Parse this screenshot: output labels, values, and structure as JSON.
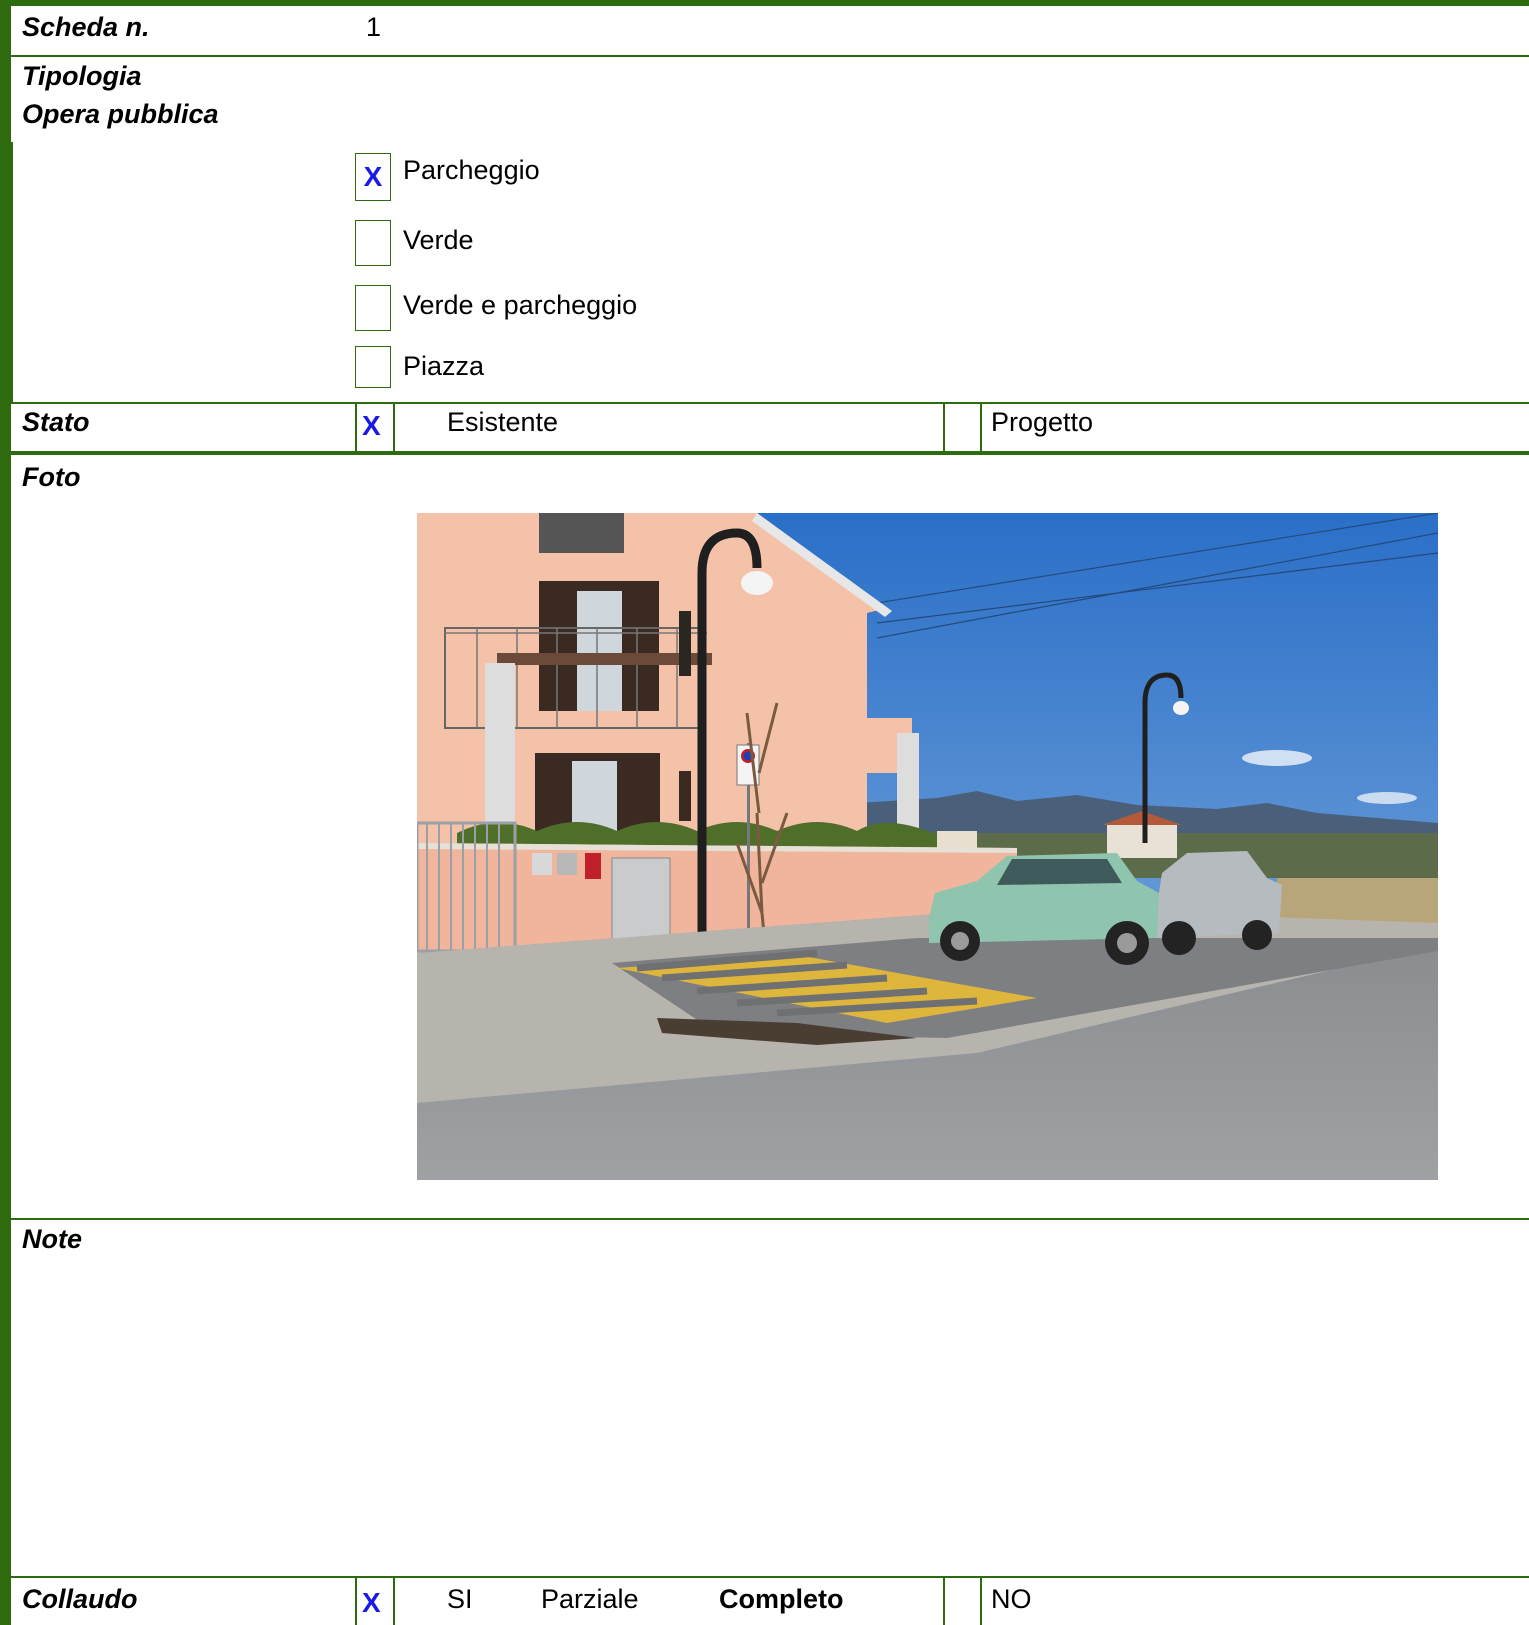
{
  "scheda": {
    "label": "Scheda n.",
    "value": "1"
  },
  "tipologia": {
    "label_line1": "Tipologia",
    "label_line2": "Opera pubblica",
    "options": [
      {
        "label": "Parcheggio",
        "mark": "X"
      },
      {
        "label": "Verde",
        "mark": ""
      },
      {
        "label": "Verde e parcheggio",
        "mark": ""
      },
      {
        "label": "Piazza",
        "mark": ""
      }
    ]
  },
  "stato": {
    "label": "Stato",
    "esistente_mark": "X",
    "esistente_label": "Esistente",
    "progetto_mark": "",
    "progetto_label": "Progetto"
  },
  "foto": {
    "label": "Foto"
  },
  "note": {
    "label": "Note",
    "text": ""
  },
  "collaudo": {
    "label": "Collaudo",
    "si_mark": "X",
    "si_label": "SI",
    "parziale_label": "Parziale",
    "completo_label": "Completo",
    "no_mark": "",
    "no_label": "NO"
  },
  "colors": {
    "border": "#2e6b0e",
    "check_mark": "#1a1ae6"
  }
}
